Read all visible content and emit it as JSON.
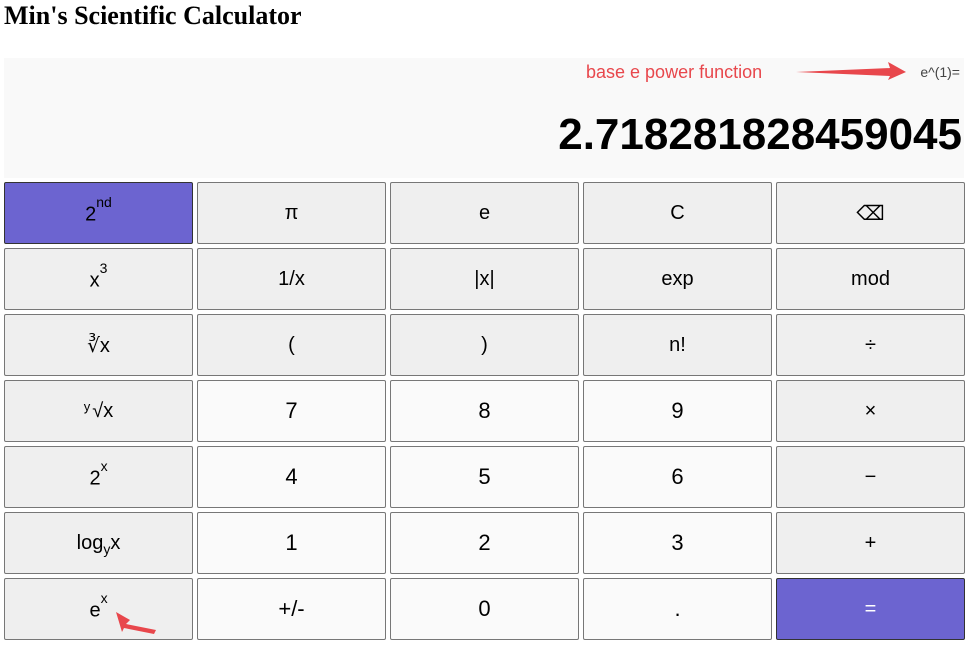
{
  "app_title": "Min's Scientific Calculator",
  "display": {
    "expression": "e^(1)=",
    "result": "2.718281828459045"
  },
  "annotation": {
    "label": "base e power function",
    "color": "#e8474c"
  },
  "colors": {
    "accent": "#6c64d0",
    "function_key_bg": "#efefef",
    "number_key_bg": "#fafafa"
  },
  "keys": [
    {
      "id": "second",
      "main": "2",
      "sup": "nd",
      "style": "accent",
      "name": "second-function-button"
    },
    {
      "id": "pi",
      "main": "π",
      "style": "func",
      "name": "pi-button"
    },
    {
      "id": "e",
      "main": "e",
      "style": "func",
      "name": "e-constant-button"
    },
    {
      "id": "clear",
      "main": "C",
      "style": "func",
      "name": "clear-button"
    },
    {
      "id": "backspace",
      "main": "⌫",
      "style": "func",
      "name": "backspace-button"
    },
    {
      "id": "cube",
      "main": "x",
      "sup": "3",
      "style": "func",
      "name": "cube-button"
    },
    {
      "id": "recip",
      "main": "1/x",
      "style": "func",
      "name": "reciprocal-button"
    },
    {
      "id": "abs",
      "main": "|x|",
      "style": "func",
      "name": "absolute-value-button"
    },
    {
      "id": "exp",
      "main": "exp",
      "style": "func",
      "name": "exp-button"
    },
    {
      "id": "mod",
      "main": "mod",
      "style": "func",
      "name": "mod-button"
    },
    {
      "id": "cbrt",
      "main": "∛x",
      "style": "func",
      "name": "cube-root-button"
    },
    {
      "id": "lparen",
      "main": "(",
      "style": "func",
      "name": "left-paren-button"
    },
    {
      "id": "rparen",
      "main": ")",
      "style": "func",
      "name": "right-paren-button"
    },
    {
      "id": "fact",
      "main": "n!",
      "style": "func",
      "name": "factorial-button"
    },
    {
      "id": "div",
      "main": "÷",
      "style": "func",
      "name": "divide-button"
    },
    {
      "id": "yroot",
      "pre": "y",
      "main": "√x",
      "style": "func",
      "name": "y-root-button"
    },
    {
      "id": "k7",
      "main": "7",
      "style": "num",
      "name": "digit-7-button"
    },
    {
      "id": "k8",
      "main": "8",
      "style": "num",
      "name": "digit-8-button"
    },
    {
      "id": "k9",
      "main": "9",
      "style": "num",
      "name": "digit-9-button"
    },
    {
      "id": "mul",
      "main": "×",
      "style": "func",
      "name": "multiply-button"
    },
    {
      "id": "pow2",
      "main": "2",
      "sup": "x",
      "style": "func",
      "name": "two-power-button"
    },
    {
      "id": "k4",
      "main": "4",
      "style": "num",
      "name": "digit-4-button"
    },
    {
      "id": "k5",
      "main": "5",
      "style": "num",
      "name": "digit-5-button"
    },
    {
      "id": "k6",
      "main": "6",
      "style": "num",
      "name": "digit-6-button"
    },
    {
      "id": "sub",
      "main": "−",
      "style": "func",
      "name": "subtract-button"
    },
    {
      "id": "logy",
      "main": "log",
      "sub": "y",
      "tail": "x",
      "style": "func",
      "name": "log-base-y-button"
    },
    {
      "id": "k1",
      "main": "1",
      "style": "num",
      "name": "digit-1-button"
    },
    {
      "id": "k2",
      "main": "2",
      "style": "num",
      "name": "digit-2-button"
    },
    {
      "id": "k3",
      "main": "3",
      "style": "num",
      "name": "digit-3-button"
    },
    {
      "id": "add",
      "main": "+",
      "style": "func",
      "name": "add-button"
    },
    {
      "id": "epow",
      "main": "e",
      "sup": "x",
      "style": "func",
      "name": "e-power-button"
    },
    {
      "id": "neg",
      "main": "+/-",
      "style": "num",
      "name": "negate-button"
    },
    {
      "id": "k0",
      "main": "0",
      "style": "num",
      "name": "digit-0-button"
    },
    {
      "id": "dot",
      "main": ".",
      "style": "num",
      "name": "decimal-point-button"
    },
    {
      "id": "equals",
      "main": "=",
      "style": "accent-eq",
      "name": "equals-button"
    }
  ]
}
